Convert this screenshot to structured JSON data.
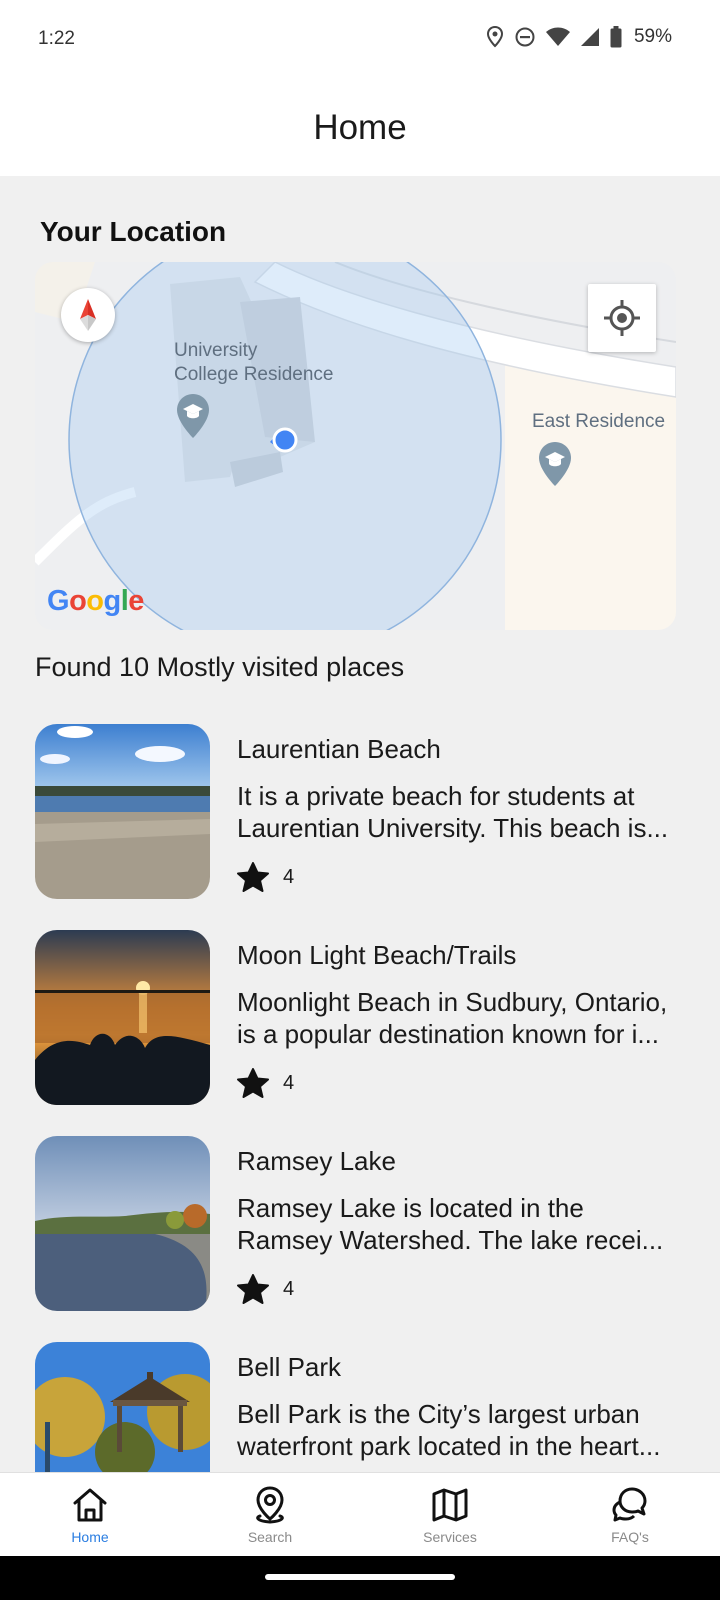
{
  "status_bar": {
    "time": "1:22",
    "battery": "59%"
  },
  "header": {
    "title": "Home"
  },
  "location_section": {
    "title": "Your Location",
    "map": {
      "labels": {
        "university_college_residence_line1": "University",
        "university_college_residence_line2": "College Residence",
        "east_residence": "East Residence"
      },
      "attribution": "Google"
    }
  },
  "results": {
    "summary": "Found 10 Mostly visited places"
  },
  "places": [
    {
      "name": "Laurentian Beach",
      "desc_line1": "It is a private beach for students at",
      "desc_line2": "Laurentian University. This beach is...",
      "rating": "4"
    },
    {
      "name": "Moon Light Beach/Trails",
      "desc_line1": "Moonlight Beach in Sudbury, Ontario,",
      "desc_line2": "is a popular destination known for i...",
      "rating": "4"
    },
    {
      "name": "Ramsey Lake",
      "desc_line1": "Ramsey Lake is located in the",
      "desc_line2": "Ramsey Watershed. The lake recei...",
      "rating": "4"
    },
    {
      "name": "Bell Park",
      "desc_line1": "Bell Park is the City’s largest urban",
      "desc_line2": "waterfront park located in the heart..."
    }
  ],
  "bottom_nav": [
    {
      "label": "Home",
      "icon": "home-icon",
      "active": true
    },
    {
      "label": "Search",
      "icon": "location-pin-icon",
      "active": false
    },
    {
      "label": "Services",
      "icon": "map-icon",
      "active": false
    },
    {
      "label": "FAQ's",
      "icon": "chat-bubbles-icon",
      "active": false
    }
  ],
  "colors": {
    "accent": "#2a7de1",
    "background": "#f0f0f0",
    "location_dot": "#4285f4"
  }
}
